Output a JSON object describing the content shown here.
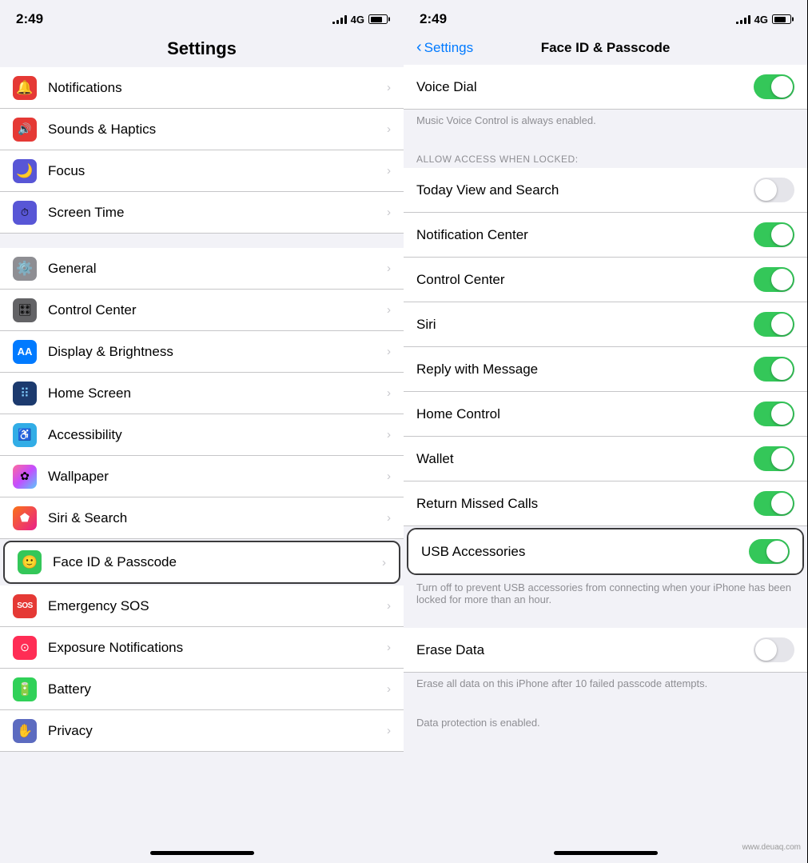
{
  "left": {
    "status": {
      "time": "2:49",
      "network": "4G"
    },
    "title": "Settings",
    "groups": [
      {
        "items": [
          {
            "id": "notifications",
            "label": "Notifications",
            "iconBg": "icon-red",
            "icon": "🔔"
          },
          {
            "id": "sounds",
            "label": "Sounds & Haptics",
            "iconBg": "icon-red2",
            "icon": "🔊"
          },
          {
            "id": "focus",
            "label": "Focus",
            "iconBg": "icon-purple",
            "icon": "🌙"
          },
          {
            "id": "screen-time",
            "label": "Screen Time",
            "iconBg": "icon-purple2",
            "icon": "⏱"
          }
        ]
      },
      {
        "items": [
          {
            "id": "general",
            "label": "General",
            "iconBg": "icon-gray",
            "icon": "⚙️"
          },
          {
            "id": "control-center",
            "label": "Control Center",
            "iconBg": "icon-gray2",
            "icon": "🎛"
          },
          {
            "id": "display",
            "label": "Display & Brightness",
            "iconBg": "icon-blue",
            "icon": "AA"
          },
          {
            "id": "home-screen",
            "label": "Home Screen",
            "iconBg": "icon-blue2",
            "icon": "⠿"
          },
          {
            "id": "accessibility",
            "label": "Accessibility",
            "iconBg": "icon-cyan",
            "icon": "♿"
          },
          {
            "id": "wallpaper",
            "label": "Wallpaper",
            "iconBg": "icon-teal",
            "icon": "✿"
          },
          {
            "id": "siri-search",
            "label": "Siri & Search",
            "iconBg": "icon-gradient",
            "icon": "⬟"
          },
          {
            "id": "face-id",
            "label": "Face ID & Passcode",
            "iconBg": "icon-green",
            "icon": "🙂",
            "highlighted": true
          },
          {
            "id": "emergency-sos",
            "label": "Emergency SOS",
            "iconBg": "icon-sos",
            "icon": "SOS"
          },
          {
            "id": "exposure",
            "label": "Exposure Notifications",
            "iconBg": "icon-pink",
            "icon": "⊙"
          },
          {
            "id": "battery",
            "label": "Battery",
            "iconBg": "icon-green2",
            "icon": "🔋"
          },
          {
            "id": "privacy",
            "label": "Privacy",
            "iconBg": "icon-indigo",
            "icon": "✋"
          }
        ]
      }
    ]
  },
  "right": {
    "status": {
      "time": "2:49",
      "network": "4G"
    },
    "back_label": "Settings",
    "title": "Face ID & Passcode",
    "sections": [
      {
        "rows": [
          {
            "id": "voice-dial",
            "label": "Voice Dial",
            "toggle": true
          }
        ],
        "note": "Music Voice Control is always enabled."
      },
      {
        "header": "ALLOW ACCESS WHEN LOCKED:",
        "rows": [
          {
            "id": "today-view",
            "label": "Today View and Search",
            "toggle": false
          },
          {
            "id": "notification-center",
            "label": "Notification Center",
            "toggle": true
          },
          {
            "id": "control-center",
            "label": "Control Center",
            "toggle": true
          },
          {
            "id": "siri",
            "label": "Siri",
            "toggle": true
          },
          {
            "id": "reply-message",
            "label": "Reply with Message",
            "toggle": true
          },
          {
            "id": "home-control",
            "label": "Home Control",
            "toggle": true
          },
          {
            "id": "wallet",
            "label": "Wallet",
            "toggle": true
          },
          {
            "id": "return-missed",
            "label": "Return Missed Calls",
            "toggle": true
          },
          {
            "id": "usb-accessories",
            "label": "USB Accessories",
            "toggle": true,
            "highlighted": true
          }
        ],
        "usb_note": "Turn off to prevent USB accessories from connecting when your iPhone has been locked for more than an hour."
      },
      {
        "rows": [
          {
            "id": "erase-data",
            "label": "Erase Data",
            "toggle": false
          }
        ],
        "note": "Erase all data on this iPhone after 10 failed passcode attempts.",
        "footer": "Data protection is enabled."
      }
    ]
  }
}
